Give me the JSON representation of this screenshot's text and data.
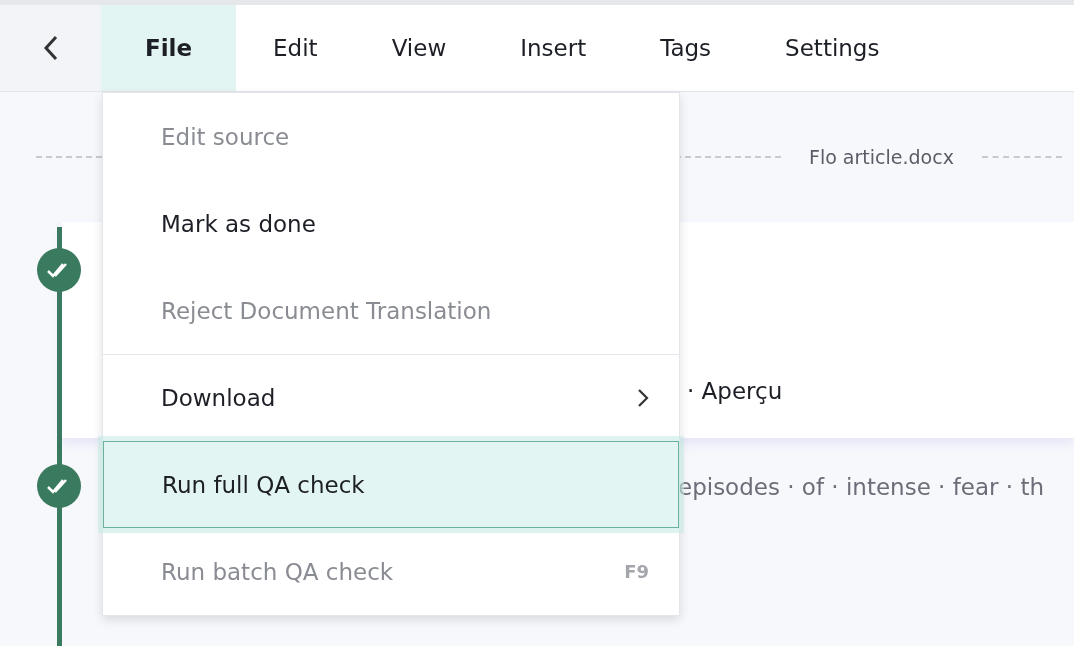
{
  "menu_bar": {
    "items": [
      {
        "label": "File",
        "selected": true
      },
      {
        "label": "Edit",
        "selected": false
      },
      {
        "label": "View",
        "selected": false
      },
      {
        "label": "Insert",
        "selected": false
      },
      {
        "label": "Tags",
        "selected": false
      },
      {
        "label": "Settings",
        "selected": false
      }
    ]
  },
  "file_menu": {
    "items": [
      {
        "label": "Edit source",
        "disabled": true,
        "selected": false,
        "divider_before": false
      },
      {
        "label": "Mark as done",
        "disabled": false,
        "selected": false,
        "divider_before": false
      },
      {
        "label": "Reject Document Translation",
        "disabled": true,
        "selected": false,
        "divider_before": false
      },
      {
        "label": "Download",
        "disabled": false,
        "selected": false,
        "divider_before": true,
        "submenu": true
      },
      {
        "label": "Run full QA check",
        "disabled": false,
        "selected": true,
        "divider_before": false
      },
      {
        "label": "Run batch QA check",
        "disabled": true,
        "selected": false,
        "divider_before": false,
        "shortcut": "F9"
      }
    ]
  },
  "document": {
    "file_name": "Flo article.docx"
  },
  "segments": [
    {
      "done": true,
      "text": "· Aperçu",
      "active": true
    },
    {
      "done": true,
      "text": "episodes · of · intense · fear · th",
      "active": false
    }
  ]
}
